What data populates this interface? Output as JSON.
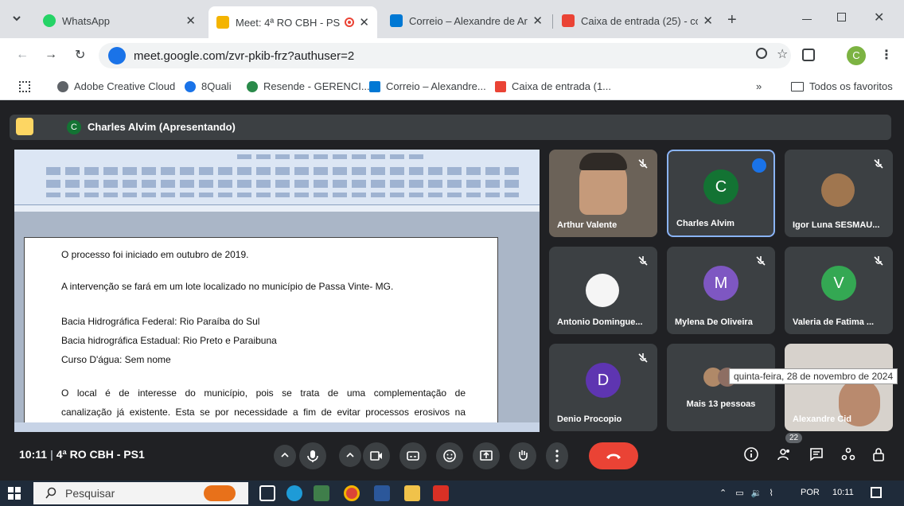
{
  "browser": {
    "tabs": [
      {
        "title": "WhatsApp",
        "color": "#25d366",
        "active": false
      },
      {
        "title": "Meet: 4ª RO CBH - PS",
        "color": "#f4b400",
        "active": true
      },
      {
        "title": "Correio – Alexandre de Ar",
        "color": "#0078d4",
        "active": false
      },
      {
        "title": "Caixa de entrada (25) - co",
        "color": "#ea4335",
        "active": false
      }
    ],
    "url": "meet.google.com/zvr-pkib-frz?authuser=2",
    "profile_letter": "C",
    "bookmarks": [
      {
        "label": "Adobe Creative Cloud",
        "color": "#5f6368"
      },
      {
        "label": "8Quali",
        "color": "#1a73e8"
      },
      {
        "label": "Resende - GERENCI...",
        "color": "#2a8a4a"
      },
      {
        "label": "Correio – Alexandre...",
        "color": "#0078d4"
      },
      {
        "label": "Caixa de entrada (1...",
        "color": "#ea4335"
      }
    ],
    "bookmarks_more": "»",
    "all_favorites": "Todos os favoritos"
  },
  "meet": {
    "presenter_initial": "C",
    "presenter_label": "Charles Alvim (Apresentando)",
    "document": {
      "lines": [
        "O processo foi iniciado em outubro de 2019.",
        "A intervenção se fará em um lote localizado no município de Passa Vinte- MG.",
        "Bacia Hidrográfica Federal: Rio Paraíba do Sul",
        "Bacia hidrográfica Estadual: Rio Preto e Paraibuna",
        "Curso D'água: Sem nome",
        "O local é de interesse do município, pois se trata de uma complementação de",
        "canalização já existente. Esta se por necessidade a fim de evitar processos erosivos na"
      ]
    },
    "participants": [
      {
        "name": "Arthur Valente",
        "type": "video",
        "muted": true
      },
      {
        "name": "Charles Alvim",
        "type": "avatar",
        "initial": "C",
        "color": "#137333",
        "speaking": true
      },
      {
        "name": "Igor Luna SESMAU...",
        "type": "photo",
        "muted": true
      },
      {
        "name": "Antonio Domingue...",
        "type": "photo",
        "muted": true
      },
      {
        "name": "Mylena De Oliveira",
        "type": "avatar",
        "initial": "M",
        "color": "#7e57c2",
        "muted": true
      },
      {
        "name": "Valeria de Fatima ...",
        "type": "avatar",
        "initial": "V",
        "color": "#34a853",
        "muted": true
      },
      {
        "name": "Denio Procopio",
        "type": "avatar",
        "initial": "D",
        "color": "#5e35b1",
        "muted": true
      },
      {
        "name": "Mais 13 pessoas",
        "type": "group"
      },
      {
        "name": "Alexandre Cid",
        "type": "video"
      }
    ],
    "meeting_time": "10:11",
    "meeting_name": "4ª RO CBH - PS1",
    "people_count": "22",
    "tooltip": "quinta-feira, 28 de novembro de 2024"
  },
  "taskbar": {
    "search_placeholder": "Pesquisar",
    "language": "POR",
    "clock": "10:11"
  }
}
